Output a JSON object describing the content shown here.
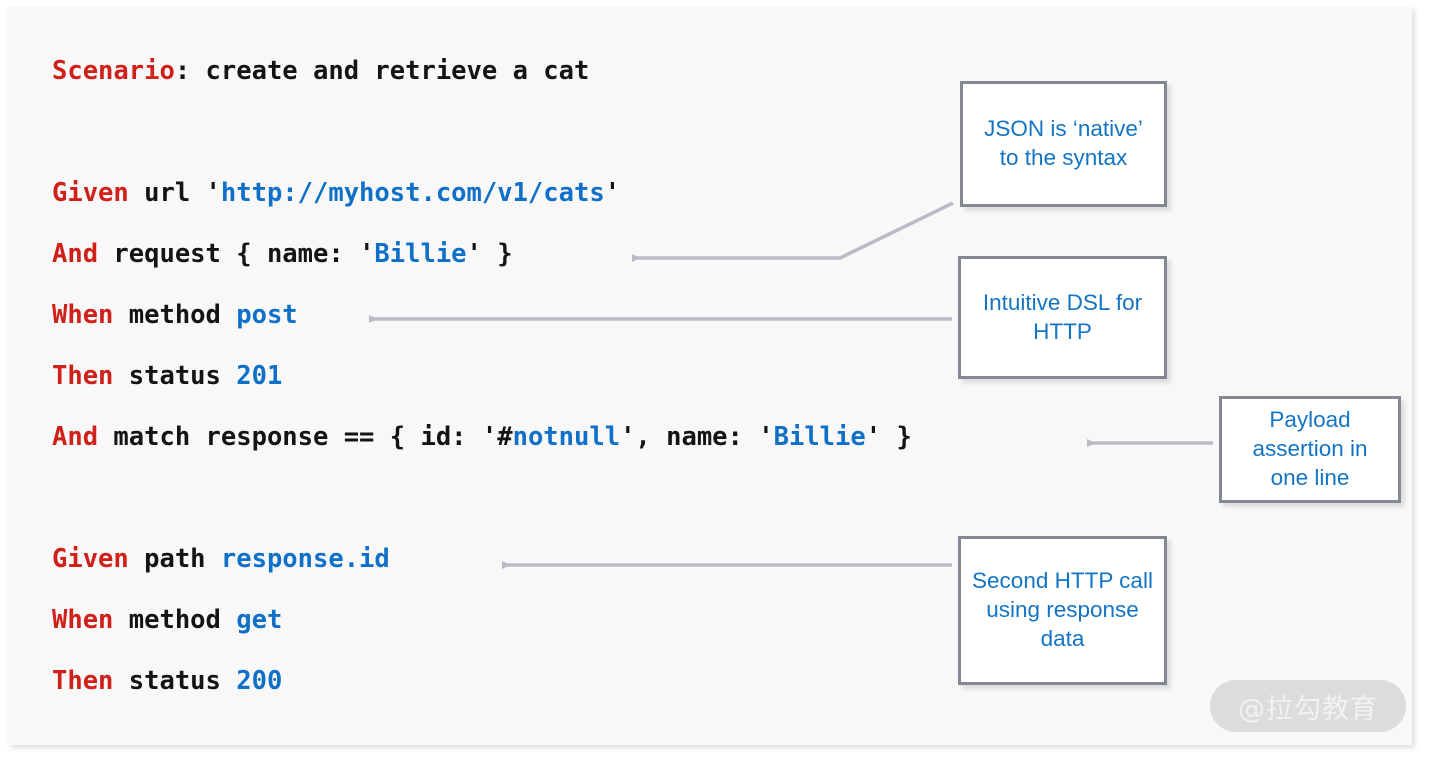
{
  "slide": {
    "background_color": "#f8f8f8",
    "keyword_color": "#d0201a",
    "value_color": "#1070c8",
    "plain_color": "#141414",
    "callout_border_color": "#848890",
    "callout_text_color": "#1474c4",
    "arrow_color": "#b9bcc4"
  },
  "code": {
    "lines": [
      {
        "id": "scenario",
        "tokens": [
          {
            "text": "Scenario",
            "style": "kw"
          },
          {
            "text": ": create and retrieve a cat",
            "style": "pln"
          }
        ]
      },
      {
        "id": "blank-1",
        "tokens": []
      },
      {
        "id": "given-url",
        "tokens": [
          {
            "text": "Given",
            "style": "kw"
          },
          {
            "text": " url ",
            "style": "pln"
          },
          {
            "text": "'",
            "style": "pln"
          },
          {
            "text": "http://myhost.com/v1/cats",
            "style": "val"
          },
          {
            "text": "'",
            "style": "pln"
          }
        ]
      },
      {
        "id": "and-request",
        "tokens": [
          {
            "text": "And",
            "style": "kw"
          },
          {
            "text": " request { name: ",
            "style": "pln"
          },
          {
            "text": "'",
            "style": "pln"
          },
          {
            "text": "Billie",
            "style": "val"
          },
          {
            "text": "'",
            "style": "pln"
          },
          {
            "text": " }",
            "style": "pln"
          }
        ]
      },
      {
        "id": "when-post",
        "tokens": [
          {
            "text": "When",
            "style": "kw"
          },
          {
            "text": " method ",
            "style": "pln"
          },
          {
            "text": "post",
            "style": "val"
          }
        ]
      },
      {
        "id": "then-201",
        "tokens": [
          {
            "text": "Then",
            "style": "kw"
          },
          {
            "text": " status ",
            "style": "pln"
          },
          {
            "text": "201",
            "style": "val"
          }
        ]
      },
      {
        "id": "and-match",
        "tokens": [
          {
            "text": "And",
            "style": "kw"
          },
          {
            "text": " match response == { id: ",
            "style": "pln"
          },
          {
            "text": "'#",
            "style": "pln"
          },
          {
            "text": "notnull",
            "style": "val"
          },
          {
            "text": "'",
            "style": "pln"
          },
          {
            "text": ", name: ",
            "style": "pln"
          },
          {
            "text": "'",
            "style": "pln"
          },
          {
            "text": "Billie",
            "style": "val"
          },
          {
            "text": "'",
            "style": "pln"
          },
          {
            "text": " }",
            "style": "pln"
          }
        ]
      },
      {
        "id": "blank-2",
        "tokens": []
      },
      {
        "id": "given-path",
        "tokens": [
          {
            "text": "Given",
            "style": "kw"
          },
          {
            "text": " path ",
            "style": "pln"
          },
          {
            "text": "response.id",
            "style": "val"
          }
        ]
      },
      {
        "id": "when-get",
        "tokens": [
          {
            "text": "When",
            "style": "kw"
          },
          {
            "text": " method ",
            "style": "pln"
          },
          {
            "text": "get",
            "style": "val"
          }
        ]
      },
      {
        "id": "then-200",
        "tokens": [
          {
            "text": "Then",
            "style": "kw"
          },
          {
            "text": " status ",
            "style": "pln"
          },
          {
            "text": "200",
            "style": "val"
          }
        ]
      }
    ]
  },
  "callouts": {
    "json_native": "JSON is ‘native’ to the syntax",
    "intuitive_dsl": "Intuitive DSL for HTTP",
    "payload_assertion": "Payload assertion in one line",
    "second_http": "Second HTTP call using response data"
  },
  "watermark": {
    "text": "@拉勾教育"
  }
}
